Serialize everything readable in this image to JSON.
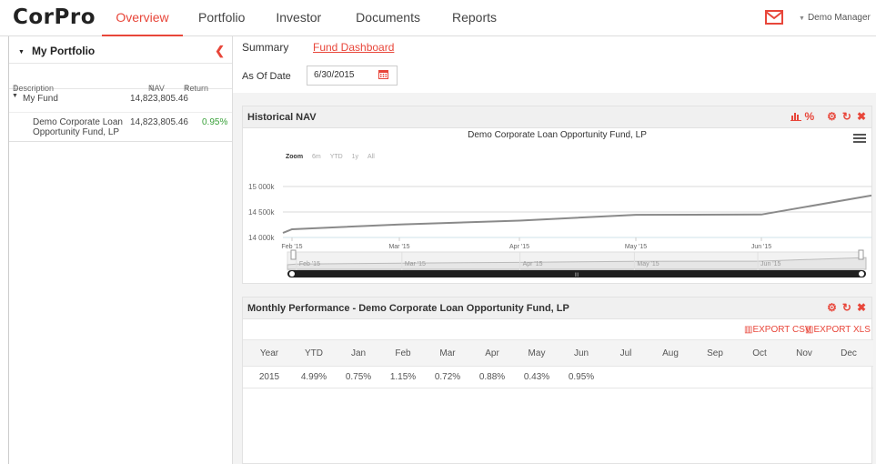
{
  "app": {
    "logo": "CorPro"
  },
  "nav": {
    "tabs": [
      "Overview",
      "Portfolio",
      "Investor",
      "Documents",
      "Reports"
    ],
    "active": 0
  },
  "user": {
    "name": "Demo Manager"
  },
  "portfolio": {
    "title": "My Portfolio",
    "columns": {
      "description": "Description",
      "nav": "NAV",
      "return": "Return"
    },
    "fund": {
      "name": "My Fund",
      "nav": "14,823,805.46"
    },
    "holding": {
      "name_line1": "Demo Corporate Loan",
      "name_line2": "Opportunity Fund, LP",
      "nav": "14,823,805.46",
      "return": "0.95%"
    }
  },
  "summary": {
    "label": "Summary",
    "link": "Fund Dashboard",
    "asof_label": "As Of Date",
    "asof_value": "6/30/2015"
  },
  "historical_nav": {
    "title": "Historical NAV",
    "tool_percent": "%",
    "chart_title": "Demo Corporate Loan Opportunity Fund, LP",
    "zoom_label": "Zoom",
    "zoom_options": [
      "6m",
      "YTD",
      "1y",
      "All"
    ],
    "y_ticks": [
      "15 000k",
      "14 500k",
      "14 000k"
    ],
    "x_ticks": [
      "Feb '15",
      "Mar '15",
      "Apr '15",
      "May '15",
      "Jun '15"
    ],
    "nav_x_ticks": [
      "Feb '15",
      "Mar '15",
      "Apr '15",
      "May '15",
      "Jun '15"
    ]
  },
  "chart_data": {
    "type": "line",
    "title": "Demo Corporate Loan Opportunity Fund, LP",
    "xlabel": "",
    "ylabel": "",
    "ylim": [
      14000,
      15000
    ],
    "x": [
      "Jan '15",
      "Feb '15",
      "Mar '15",
      "Apr '15",
      "May '15",
      "Jun '15",
      "Jun 30 '15"
    ],
    "series": [
      {
        "values": [
          14090,
          14160,
          14255,
          14330,
          14445,
          14450,
          14823
        ]
      }
    ]
  },
  "performance": {
    "title": "Monthly Performance - Demo Corporate Loan Opportunity Fund, LP",
    "export_csv": "EXPORT CSV",
    "export_xls": "EXPORT XLS",
    "headers": [
      "Year",
      "YTD",
      "Jan",
      "Feb",
      "Mar",
      "Apr",
      "May",
      "Jun",
      "Jul",
      "Aug",
      "Sep",
      "Oct",
      "Nov",
      "Dec"
    ],
    "rows": [
      [
        "2015",
        "4.99%",
        "0.75%",
        "1.15%",
        "0.72%",
        "0.88%",
        "0.43%",
        "0.95%",
        "",
        "",
        "",
        "",
        "",
        ""
      ]
    ]
  },
  "colors": {
    "accent": "#e8463a",
    "line": "#8a8a8a",
    "positive": "#3aa13a"
  }
}
